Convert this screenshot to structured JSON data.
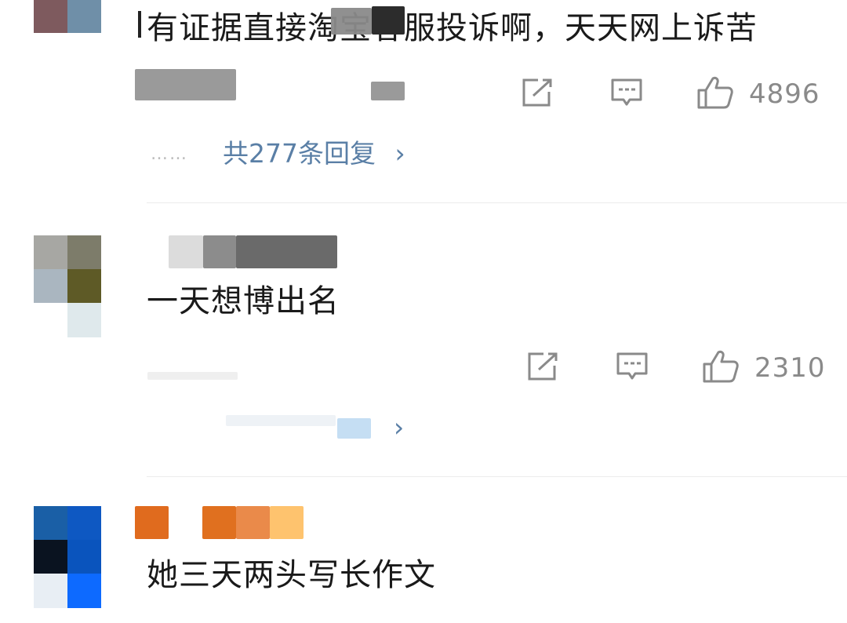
{
  "comments": [
    {
      "text": "有证据直接淘宝客服投诉啊，天天网上诉苦",
      "like_count": "4896",
      "replies_prefix": "……",
      "replies_label": "共277条回复",
      "chevron": "›"
    },
    {
      "text": "一天想博出名",
      "like_count": "2310",
      "chevron": "›"
    },
    {
      "text": "她三天两头写长作文"
    }
  ],
  "icons": {
    "share": "share-icon",
    "comment": "comment-icon",
    "like": "thumbs-up-icon"
  },
  "colors": {
    "text": "#1a1a1a",
    "muted": "#8a8a8a",
    "link": "#5a7fa6",
    "divider": "#ececec",
    "username_orange": "#e0701f"
  }
}
